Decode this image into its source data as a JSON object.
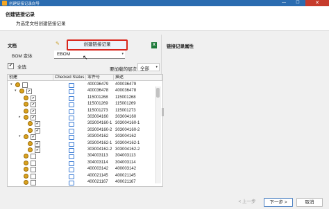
{
  "window": {
    "title": "创建链接记录向导",
    "minimize": "—",
    "maximize": "☐",
    "close": "✕"
  },
  "header": {
    "title": "创建链接记录",
    "subtitle": "为选定文档创建链接记录"
  },
  "document": {
    "label": "文档",
    "create_button": "创建链接记录"
  },
  "properties": {
    "label": "链接记录属性"
  },
  "bom": {
    "label": "BOM 变体",
    "value": "EBOM",
    "arrow": "▾"
  },
  "select_all": {
    "label": "全选",
    "checked": "✔"
  },
  "level": {
    "label": "要加载的层次",
    "value": "全部",
    "arrow": "▾"
  },
  "grid": {
    "columns": [
      "创建",
      "Checked Status",
      "零件号",
      "描述"
    ],
    "rows": [
      {
        "expand": "▾",
        "checked": "",
        "part": "400036479",
        "desc": "400036479"
      },
      {
        "expand": "▾",
        "checked": "✔",
        "part": "400036478",
        "desc": "400036478"
      },
      {
        "expand": "",
        "checked": "✔",
        "part": "115001268",
        "desc": "115001268"
      },
      {
        "expand": "",
        "checked": "✔",
        "part": "115001269",
        "desc": "115001269"
      },
      {
        "expand": "",
        "checked": "✔",
        "part": "115001273",
        "desc": "115001273"
      },
      {
        "expand": "▸",
        "checked": "✔",
        "part": "303004160",
        "desc": "303004160"
      },
      {
        "expand": "",
        "checked": "✔",
        "part": "303004160-1",
        "desc": "303004160-1"
      },
      {
        "expand": "",
        "checked": "✔",
        "part": "303004160-2",
        "desc": "303004160-2"
      },
      {
        "expand": "▾",
        "checked": "✔",
        "part": "303004162",
        "desc": "303004162"
      },
      {
        "expand": "",
        "checked": "✔",
        "part": "303004162-1",
        "desc": "303004162-1"
      },
      {
        "expand": "",
        "checked": "✔",
        "part": "303004162-2",
        "desc": "303004162-2"
      },
      {
        "expand": "",
        "checked": "",
        "part": "304003113",
        "desc": "304003113"
      },
      {
        "expand": "",
        "checked": "",
        "part": "304003114",
        "desc": "304003114"
      },
      {
        "expand": "",
        "checked": "",
        "part": "400003142",
        "desc": "400003142"
      },
      {
        "expand": "",
        "checked": "",
        "part": "400021145",
        "desc": "400021145"
      },
      {
        "expand": "",
        "checked": "",
        "part": "400021167",
        "desc": "400021167"
      }
    ]
  },
  "footer": {
    "back": "< 上一步",
    "next": "下一步 >",
    "cancel": "取消"
  },
  "colors": {
    "titlebar": "#2b6cb0",
    "highlight_border": "#d9261c",
    "status_icon": "#3a7bd5"
  }
}
